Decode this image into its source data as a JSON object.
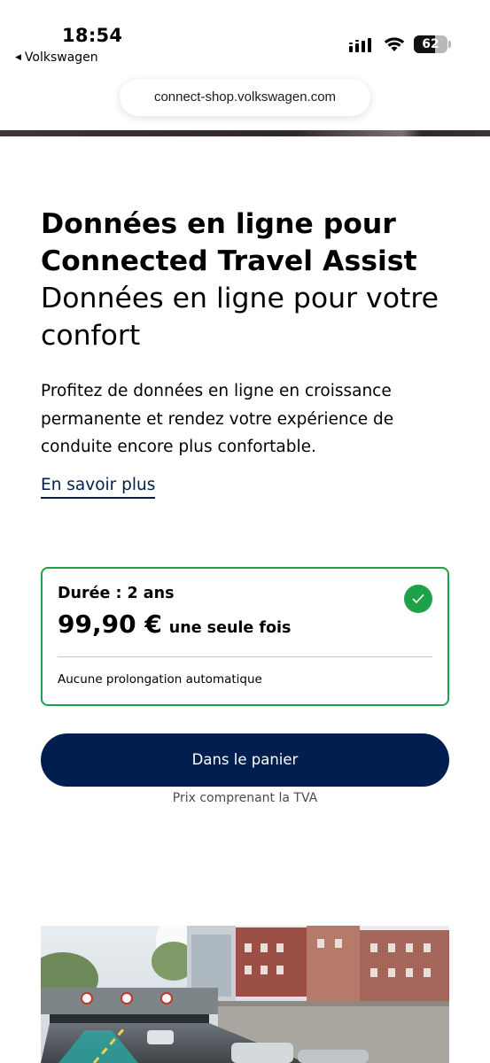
{
  "status_bar": {
    "time": "18:54",
    "back_label": "Volkswagen",
    "battery_level": "62",
    "icons": [
      "signal-icon",
      "wifi-icon",
      "battery-icon"
    ]
  },
  "browser": {
    "url": "connect-shop.volkswagen.com"
  },
  "product": {
    "title": "Données en ligne pour Connected Travel Assist",
    "subtitle": "Données en ligne pour votre confort",
    "description": "Profitez de données en ligne en croissance permanente et rendez votre expérience de conduite encore plus confortable.",
    "learn_more": "En savoir plus"
  },
  "offer": {
    "duration": "Durée : 2 ans",
    "price": "99,90 €",
    "price_suffix": "une seule fois",
    "note": "Aucune prolongation automatique",
    "selected": true
  },
  "cart": {
    "button_label": "Dans le panier",
    "vat_note": "Prix comprenant la TVA"
  },
  "colors": {
    "brand_navy": "#001e50",
    "selected_green": "#1fa14a"
  }
}
